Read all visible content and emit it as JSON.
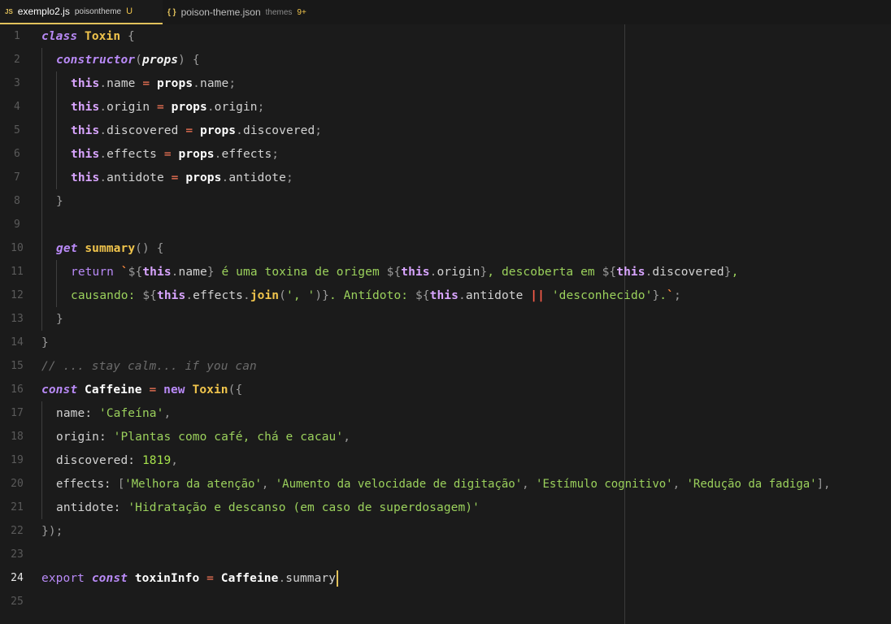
{
  "tabs": [
    {
      "icon": "JS",
      "name": "exemplo2.js",
      "desc": "poisontheme",
      "badge": "U"
    },
    {
      "icon": "{ }",
      "name": "poison-theme.json",
      "desc": "themes",
      "badge": "9+"
    }
  ],
  "editor": {
    "current_line": 24,
    "lines": [
      {
        "n": "1"
      },
      {
        "n": "2"
      },
      {
        "n": "3"
      },
      {
        "n": "4"
      },
      {
        "n": "5"
      },
      {
        "n": "6"
      },
      {
        "n": "7"
      },
      {
        "n": "8"
      },
      {
        "n": "9"
      },
      {
        "n": "10"
      },
      {
        "n": "11"
      },
      {
        "n": "12"
      },
      {
        "n": "13"
      },
      {
        "n": "14"
      },
      {
        "n": "15"
      },
      {
        "n": "16"
      },
      {
        "n": "17"
      },
      {
        "n": "18"
      },
      {
        "n": "19"
      },
      {
        "n": "20"
      },
      {
        "n": "21"
      },
      {
        "n": "22"
      },
      {
        "n": "23"
      },
      {
        "n": "24"
      },
      {
        "n": "25"
      }
    ],
    "code": {
      "l1": [
        "class",
        " ",
        "Toxin",
        " ",
        "{"
      ],
      "l2": [
        "constructor",
        "(",
        "props",
        ")",
        " ",
        "{"
      ],
      "l3": [
        "this",
        ".",
        "name",
        " = ",
        "props",
        ".",
        "name",
        ";"
      ],
      "l4": [
        "this",
        ".",
        "origin",
        " = ",
        "props",
        ".",
        "origin",
        ";"
      ],
      "l5": [
        "this",
        ".",
        "discovered",
        " = ",
        "props",
        ".",
        "discovered",
        ";"
      ],
      "l6": [
        "this",
        ".",
        "effects",
        " = ",
        "props",
        ".",
        "effects",
        ";"
      ],
      "l7": [
        "this",
        ".",
        "antidote",
        " = ",
        "props",
        ".",
        "antidote",
        ";"
      ],
      "l8": [
        "}"
      ],
      "l10": [
        "get",
        " ",
        "summary",
        "()",
        " ",
        "{"
      ],
      "l11": [
        "return",
        " ",
        "`",
        "${",
        "this",
        ".",
        "name",
        "}",
        " é uma toxina de origem ",
        "${",
        "this",
        ".",
        "origin",
        "}",
        ", descoberta em ",
        "${",
        "this",
        ".",
        "discovered",
        "}",
        ","
      ],
      "l12": [
        "causando: ",
        "${",
        "this",
        ".",
        "effects",
        ".",
        "join",
        "(",
        "', '",
        ")",
        "}",
        ". Antídoto: ",
        "${",
        "this",
        ".",
        "antidote",
        " ",
        "||",
        " ",
        "'desconhecido'",
        "}",
        ".",
        "`",
        ";"
      ],
      "l13": [
        "}"
      ],
      "l14": [
        "}"
      ],
      "l15": [
        "// ... stay calm... if you can"
      ],
      "l16": [
        "const",
        " ",
        "Caffeine",
        " = ",
        "new",
        " ",
        "Toxin",
        "({"
      ],
      "l17": [
        "name: ",
        "'Cafeína'",
        ","
      ],
      "l18": [
        "origin: ",
        "'Plantas como café, chá e cacau'",
        ","
      ],
      "l19": [
        "discovered: ",
        "1819",
        ","
      ],
      "l20": [
        "effects: ",
        "[",
        "'Melhora da atenção'",
        ", ",
        "'Aumento da velocidade de digitação'",
        ", ",
        "'Estímulo cognitivo'",
        ", ",
        "'Redução da fadiga'",
        "],"
      ],
      "l21": [
        "antidote: ",
        "'Hidratação e descanso (em caso de superdosagem)'"
      ],
      "l22": [
        "});"
      ],
      "l24": [
        "export",
        " ",
        "const",
        " ",
        "toxinInfo",
        " = ",
        "Caffeine",
        ".",
        "summary"
      ]
    }
  },
  "colors": {
    "background": "#1b1b1b",
    "keyword": "#b98af7",
    "string": "#9bd15c",
    "class_name": "#f0c44c",
    "operator": "#ff7a59",
    "comment": "#6b6b6b",
    "cursor": "#e1c15b"
  }
}
